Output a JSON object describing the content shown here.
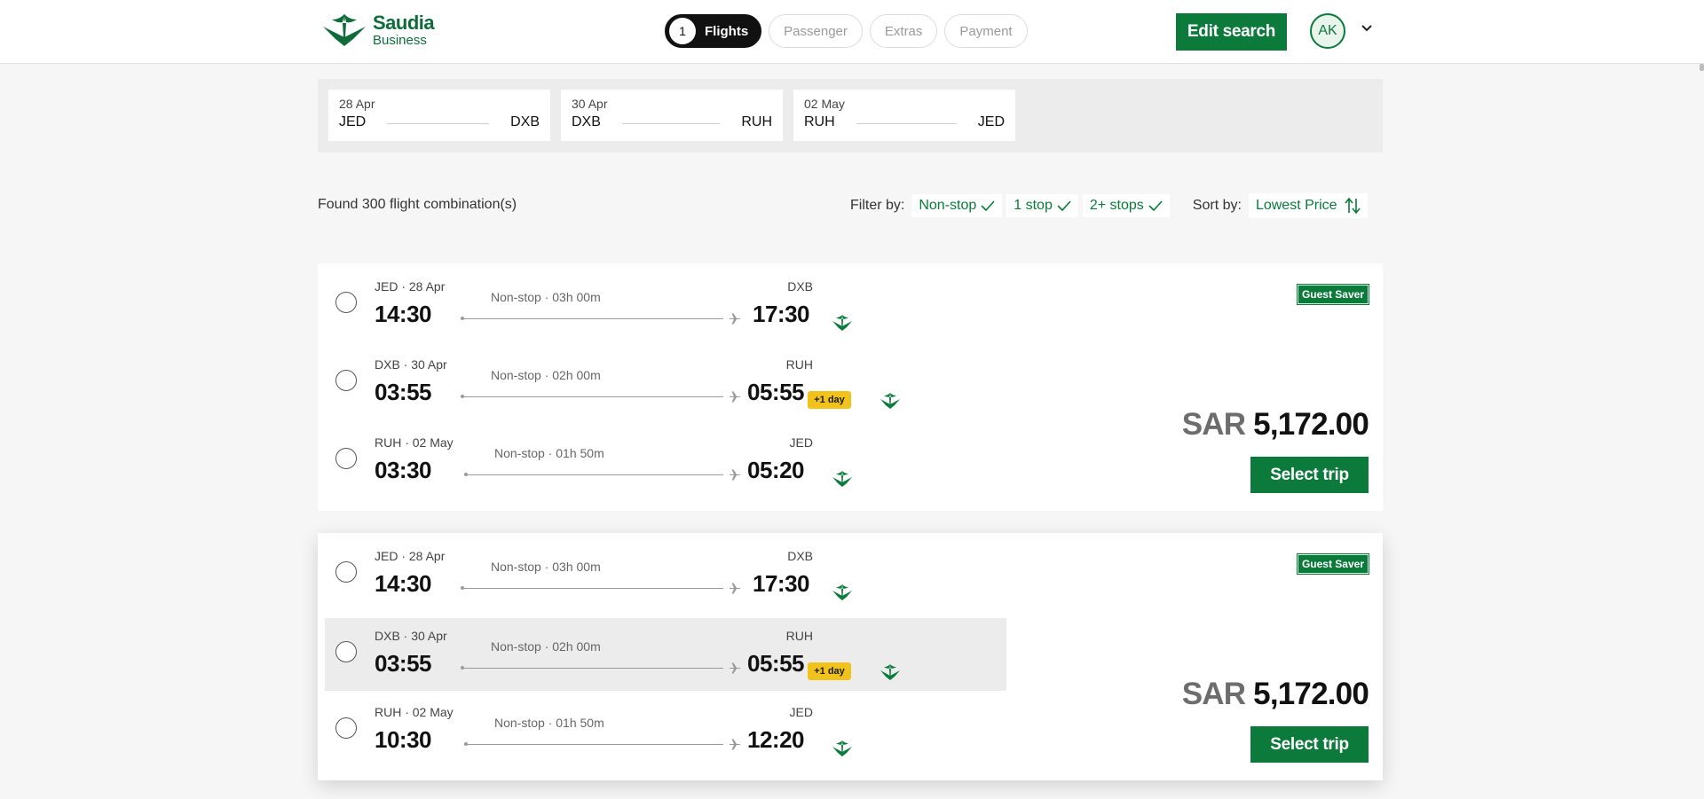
{
  "brand": {
    "line1": "Saudia",
    "line2": "Business"
  },
  "steps": [
    {
      "num": "1",
      "label": "Flights"
    },
    {
      "label": "Passenger"
    },
    {
      "label": "Extras"
    },
    {
      "label": "Payment"
    }
  ],
  "header": {
    "edit_label": "Edit search",
    "avatar_initials": "AK"
  },
  "legs": [
    {
      "date": "28 Apr",
      "from": "JED",
      "to": "DXB"
    },
    {
      "date": "30 Apr",
      "from": "DXB",
      "to": "RUH"
    },
    {
      "date": "02 May",
      "from": "RUH",
      "to": "JED"
    }
  ],
  "results_summary": "Found 300 flight combination(s)",
  "filters": {
    "label": "Filter by:",
    "options": [
      "Non-stop",
      "1 stop",
      "2+ stops"
    ],
    "sort_label": "Sort by:",
    "sort_value": "Lowest Price"
  },
  "colors": {
    "brand_green": "#0b7a3b",
    "next_day_badge": "#f1c21b"
  },
  "results": [
    {
      "badge": "Guest Saver",
      "currency": "SAR",
      "price": "5,172.00",
      "select_label": "Select trip",
      "segments": [
        {
          "dep_meta": "JED · 28 Apr",
          "dep_time": "14:30",
          "stops": "Non-stop · 03h 00m",
          "arr_meta": "DXB",
          "arr_time": "17:30"
        },
        {
          "dep_meta": "DXB · 30 Apr",
          "dep_time": "03:55",
          "stops": "Non-stop · 02h 00m",
          "arr_meta": "RUH",
          "arr_time": "05:55",
          "plus_day": "+1 day"
        },
        {
          "dep_meta": "RUH · 02 May",
          "dep_time": "03:30",
          "stops": "Non-stop · 01h 50m",
          "arr_meta": "JED",
          "arr_time": "05:20"
        }
      ]
    },
    {
      "badge": "Guest Saver",
      "currency": "SAR",
      "price": "5,172.00",
      "select_label": "Select trip",
      "segments": [
        {
          "dep_meta": "JED · 28 Apr",
          "dep_time": "14:30",
          "stops": "Non-stop · 03h 00m",
          "arr_meta": "DXB",
          "arr_time": "17:30"
        },
        {
          "dep_meta": "DXB · 30 Apr",
          "dep_time": "03:55",
          "stops": "Non-stop · 02h 00m",
          "arr_meta": "RUH",
          "arr_time": "05:55",
          "plus_day": "+1 day"
        },
        {
          "dep_meta": "RUH · 02 May",
          "dep_time": "10:30",
          "stops": "Non-stop · 01h 50m",
          "arr_meta": "JED",
          "arr_time": "12:20"
        }
      ]
    }
  ]
}
